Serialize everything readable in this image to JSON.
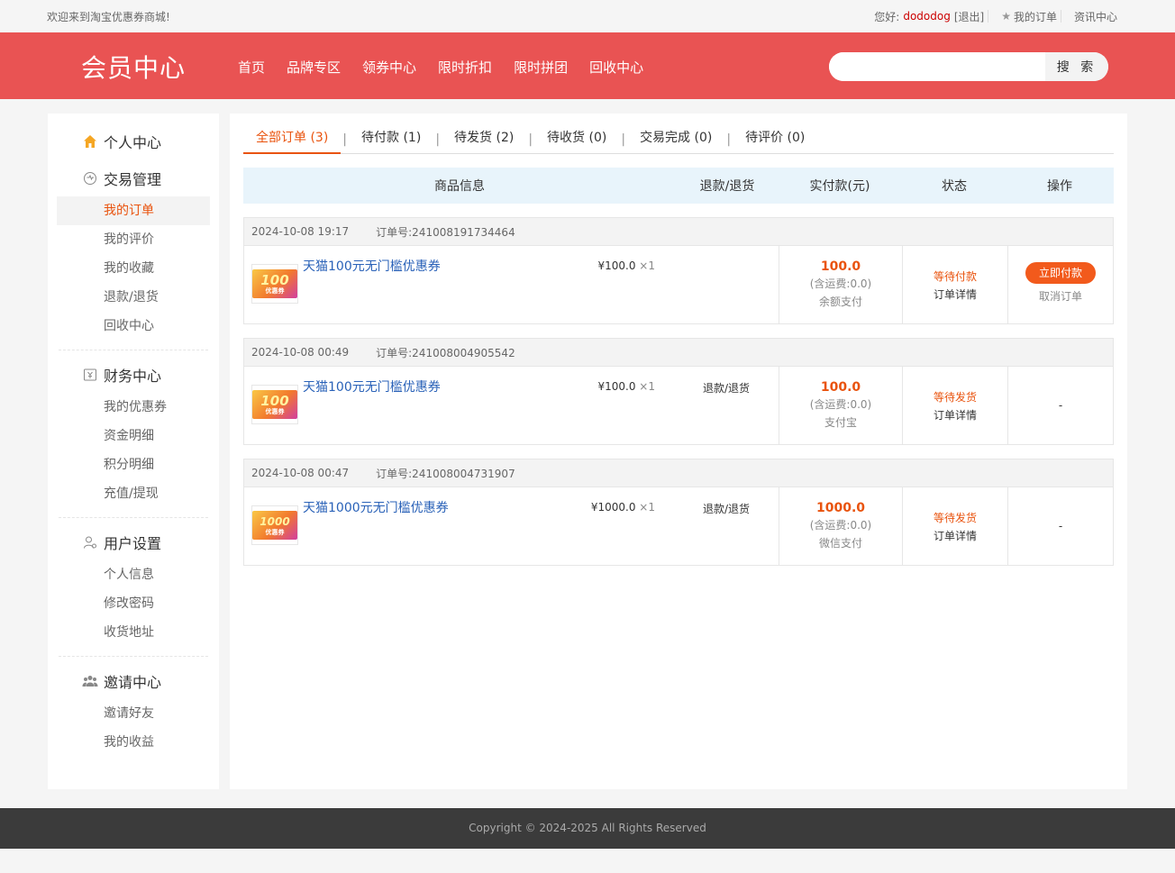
{
  "topbar": {
    "welcome": "欢迎来到淘宝优惠券商城!",
    "greeting": "您好:",
    "username": "dododog",
    "logout": "[退出]",
    "my_orders": "我的订单",
    "news": "资讯中心"
  },
  "header": {
    "logo": "会员中心",
    "nav": [
      "首页",
      "品牌专区",
      "领券中心",
      "限时折扣",
      "限时拼团",
      "回收中心"
    ],
    "search_placeholder": "",
    "search_button": "搜 索"
  },
  "sidebar": {
    "groups": [
      {
        "title": "个人中心",
        "icon": "home-icon",
        "items": []
      },
      {
        "title": "交易管理",
        "icon": "exchange-icon",
        "items": [
          "我的订单",
          "我的评价",
          "我的收藏",
          "退款/退货",
          "回收中心"
        ]
      },
      {
        "title": "财务中心",
        "icon": "finance-icon",
        "items": [
          "我的优惠券",
          "资金明细",
          "积分明细",
          "充值/提现"
        ]
      },
      {
        "title": "用户设置",
        "icon": "user-settings-icon",
        "items": [
          "个人信息",
          "修改密码",
          "收货地址"
        ]
      },
      {
        "title": "邀请中心",
        "icon": "invite-icon",
        "items": [
          "邀请好友",
          "我的收益"
        ]
      }
    ],
    "active_item": "我的订单"
  },
  "tabs": [
    {
      "label": "全部订单",
      "count": "(3)",
      "active": true
    },
    {
      "label": "待付款",
      "count": "(1)"
    },
    {
      "label": "待发货",
      "count": "(2)"
    },
    {
      "label": "待收货",
      "count": "(0)"
    },
    {
      "label": "交易完成",
      "count": "(0)"
    },
    {
      "label": "待评价",
      "count": "(0)"
    }
  ],
  "table_header": {
    "product": "商品信息",
    "refund": "退款/退货",
    "paid": "实付款(元)",
    "status": "状态",
    "action": "操作"
  },
  "orders": [
    {
      "time": "2024-10-08 19:17",
      "order_no": "订单号:241008191734464",
      "coupon_value": "100",
      "coupon_text": "优惠券",
      "product": "天猫100元无门槛优惠券",
      "price": "¥100.0",
      "qty": "×1",
      "refund": "",
      "amount": "100.0",
      "shipping": "(含运费:0.0)",
      "pay_method": "余额支付",
      "status": "等待付款",
      "detail": "订单详情",
      "action_primary": "立即付款",
      "action_secondary": "取消订单"
    },
    {
      "time": "2024-10-08 00:49",
      "order_no": "订单号:241008004905542",
      "coupon_value": "100",
      "coupon_text": "优惠券",
      "product": "天猫100元无门槛优惠券",
      "price": "¥100.0",
      "qty": "×1",
      "refund": "退款/退货",
      "amount": "100.0",
      "shipping": "(含运费:0.0)",
      "pay_method": "支付宝",
      "status": "等待发货",
      "detail": "订单详情",
      "action_text": "-"
    },
    {
      "time": "2024-10-08 00:47",
      "order_no": "订单号:241008004731907",
      "coupon_value": "1000",
      "coupon_text": "优惠券",
      "product": "天猫1000元无门槛优惠券",
      "price": "¥1000.0",
      "qty": "×1",
      "refund": "退款/退货",
      "amount": "1000.0",
      "shipping": "(含运费:0.0)",
      "pay_method": "微信支付",
      "status": "等待发货",
      "detail": "订单详情",
      "action_text": "-"
    }
  ],
  "footer": "Copyright © 2024-2025 All Rights Reserved",
  "colors": {
    "header_bg": "#e95353",
    "accent": "#e9530e",
    "link": "#2a62b8",
    "pay_button": "#f25a1c"
  }
}
